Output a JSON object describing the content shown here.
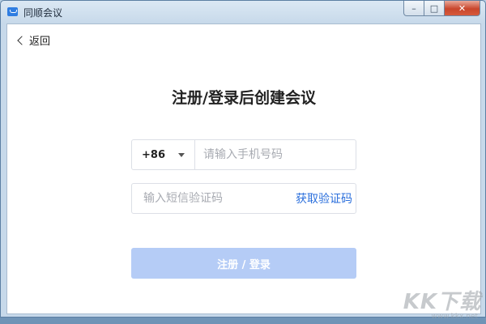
{
  "window": {
    "title": "同顺会议",
    "controls": {
      "minimize": "–",
      "maximize": "□",
      "close": "✕"
    }
  },
  "nav": {
    "back_label": "返回"
  },
  "main": {
    "heading": "注册/登录后创建会议",
    "phone": {
      "country_code": "+86",
      "placeholder": "请输入手机号码",
      "value": ""
    },
    "code": {
      "placeholder": "输入短信验证码",
      "value": "",
      "get_code_label": "获取验证码"
    },
    "submit_label": "注册 / 登录"
  },
  "watermark": {
    "text": "KK下载",
    "sub": "www.kkx.net"
  },
  "colors": {
    "link_blue": "#2b6fdc",
    "submit_disabled": "#b5ccf6",
    "border": "#dcdfe6",
    "app_icon": "#2f7de1"
  },
  "icons": {
    "app": "app-logo-icon",
    "back": "chevron-left-icon",
    "dropdown": "caret-down-icon"
  }
}
